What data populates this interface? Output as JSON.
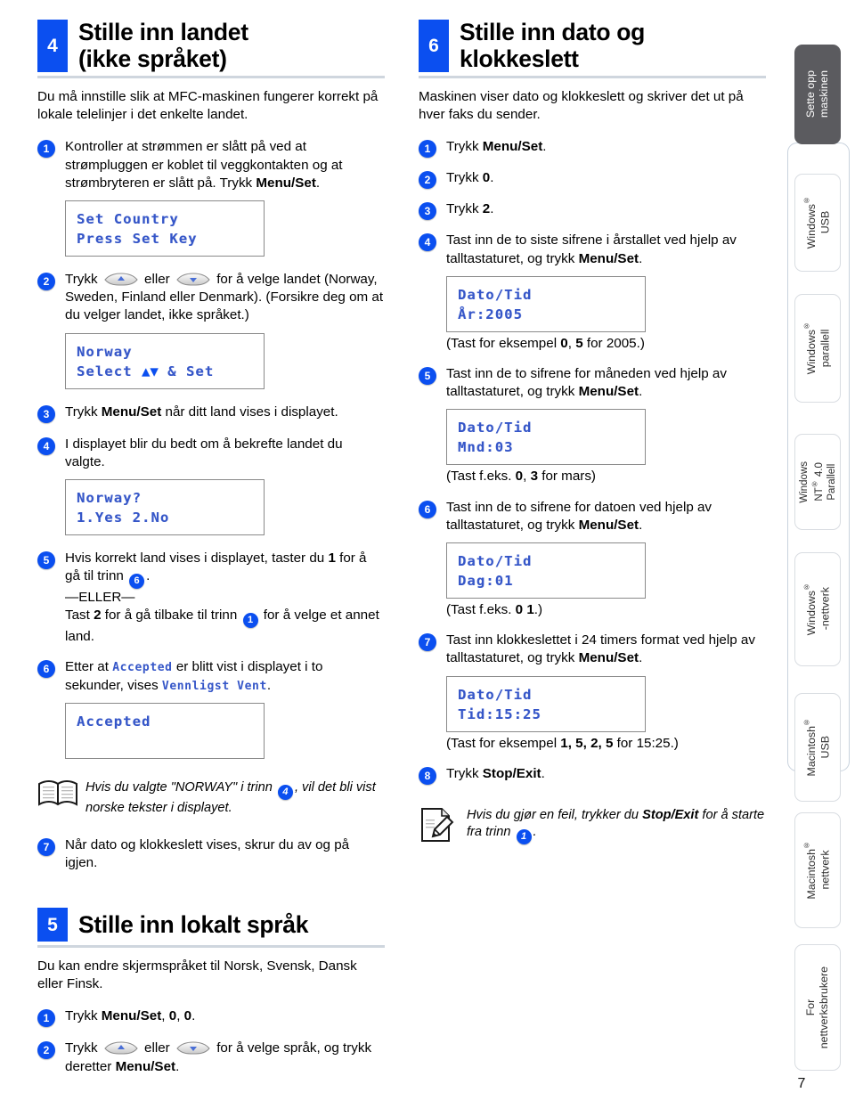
{
  "colors": {
    "accent_blue": "#0b4ff0",
    "lcd_text": "#3556c8",
    "rule_gray": "#cfd6de",
    "tab_active_bg": "#5b5b5f"
  },
  "page_number": "7",
  "left_column": {
    "section4": {
      "number": "4",
      "title_line1": "Stille inn landet",
      "title_line2": "(ikke språket)",
      "intro": "Du må innstille slik at MFC-maskinen fungerer korrekt på lokale telelinjer i det enkelte landet.",
      "steps": [
        {
          "num": "1",
          "text_before": "Kontroller at strømmen er slått på ved at strømpluggen er koblet til veggkontakten og at strømbryteren er slått på. Trykk ",
          "bold": "Menu/Set",
          "text_after": ".",
          "lcd": [
            "Set Country",
            "Press Set Key"
          ]
        },
        {
          "num": "2",
          "pre": "Trykk",
          "mid": "eller",
          "post": "for å velge landet (Norway, Sweden, Finland eller Denmark). (Forsikre deg om at du velger landet, ikke språket.)",
          "lcd_line1": "Norway",
          "lcd_line2_pre": "Select ",
          "lcd_line2_arrows": "▲▼",
          "lcd_line2_post": " & Set"
        },
        {
          "num": "3",
          "text_before": "Trykk ",
          "bold": "Menu/Set",
          "text_after": " når ditt land vises i displayet."
        },
        {
          "num": "4",
          "text": "I displayet blir du bedt om å bekrefte landet du valgte.",
          "lcd": [
            "Norway?",
            "1.Yes 2.No"
          ]
        },
        {
          "num": "5",
          "l1a": "Hvis korrekt land vises i displayet, taster du ",
          "l1b": "1",
          "l1c": " for å gå til trinn ",
          "l1ref": "6",
          "l1d": ".",
          "l2": "—ELLER—",
          "l3a": "Tast ",
          "l3b": "2",
          "l3c": " for å gå tilbake til trinn ",
          "l3ref": "1",
          "l3d": " for å velge et annet land."
        },
        {
          "num": "6",
          "a": "Etter at ",
          "lcd_a": "Accepted",
          "b": " er blitt vist i displayet i to sekunder, vises ",
          "lcd_b": "Vennligst Vent",
          "c": ".",
          "lcd": [
            "Accepted",
            ""
          ]
        }
      ],
      "tip": {
        "icon": "open-book-icon",
        "a": "Hvis du valgte \"NORWAY\" i trinn ",
        "ref": "4",
        "b": ", vil det bli vist norske tekster i displayet."
      },
      "step7": {
        "num": "7",
        "text": "Når dato og klokkeslett vises, skrur du av og på igjen."
      }
    },
    "section5": {
      "number": "5",
      "title": "Stille inn lokalt språk",
      "intro": "Du kan endre skjermspråket til Norsk, Svensk, Dansk eller Finsk.",
      "steps": [
        {
          "num": "1",
          "text_before": "Trykk ",
          "bold": "Menu/Set",
          "text_after": ", 0, 0.",
          "bold_0a": "0",
          "bold_0b": "0"
        },
        {
          "num": "2",
          "pre": "Trykk",
          "mid": "eller",
          "post": "for å velge språk, og trykk deretter ",
          "bold": "Menu/Set",
          "end": "."
        }
      ]
    }
  },
  "right_column": {
    "section6": {
      "number": "6",
      "title_line1": "Stille inn dato og",
      "title_line2": "klokkeslett",
      "intro": "Maskinen viser dato og klokkeslett og skriver det ut på hver faks du sender.",
      "steps": [
        {
          "num": "1",
          "text_before": "Trykk ",
          "bold": "Menu/Set",
          "text_after": "."
        },
        {
          "num": "2",
          "text_before": "Trykk ",
          "bold": "0",
          "text_after": "."
        },
        {
          "num": "3",
          "text_before": "Trykk ",
          "bold": "2",
          "text_after": "."
        },
        {
          "num": "4",
          "text_before": "Tast inn de to siste sifrene i årstallet ved hjelp av talltastaturet, og trykk ",
          "bold": "Menu/Set",
          "text_after": ".",
          "lcd": [
            "Dato/Tid",
            "År:2005"
          ],
          "note_a": "(Tast for eksempel ",
          "note_b1": "0",
          "note_mid": ", ",
          "note_b2": "5",
          "note_c": " for 2005.)"
        },
        {
          "num": "5",
          "text_before": "Tast inn de to sifrene for måneden ved hjelp av talltastaturet, og trykk ",
          "bold": "Menu/Set",
          "text_after": ".",
          "lcd": [
            "Dato/Tid",
            "Mnd:03"
          ],
          "note_a": "(Tast f.eks. ",
          "note_b1": "0",
          "note_mid": ", ",
          "note_b2": "3",
          "note_c": " for mars)"
        },
        {
          "num": "6",
          "text_before": "Tast inn de to sifrene for datoen ved hjelp av talltastaturet, og trykk ",
          "bold": "Menu/Set",
          "text_after": ".",
          "lcd": [
            "Dato/Tid",
            "Dag:01"
          ],
          "note_a": "(Tast f.eks. ",
          "note_b1": "0 1",
          "note_c": ".)"
        },
        {
          "num": "7",
          "text_before": "Tast inn klokkeslettet i 24 timers format ved hjelp av talltastaturet, og trykk ",
          "bold": "Menu/Set",
          "text_after": ".",
          "lcd": [
            "Dato/Tid",
            "Tid:15:25"
          ],
          "note_a": "(Tast for eksempel ",
          "note_b": "1, 5, 2, 5",
          "note_c": " for 15:25.)"
        },
        {
          "num": "8",
          "text_before": "Trykk ",
          "bold": "Stop/Exit",
          "text_after": "."
        }
      ],
      "tip": {
        "icon": "note-pencil-icon",
        "a": "Hvis du gjør en feil, trykker du ",
        "bold": "Stop/Exit",
        "b": " for å starte fra trinn ",
        "ref": "1",
        "c": "."
      }
    }
  },
  "sidebar": {
    "tabs": [
      {
        "id": "sette-opp-maskinen",
        "line1": "Sette opp",
        "line2": "maskinen",
        "active": true,
        "reg": false
      },
      {
        "id": "windows-usb",
        "line1": "Windows",
        "line2": "USB",
        "active": false,
        "reg": true
      },
      {
        "id": "windows-parallell",
        "line1": "Windows",
        "line2": "parallell",
        "active": false,
        "reg": true
      },
      {
        "id": "windows-nt-40-parallell",
        "line1": "Windows",
        "line2": "NT",
        "line3": "4.0",
        "line4": "Parallell",
        "active": false,
        "reg": true
      },
      {
        "id": "windows-nettverk",
        "line1": "Windows",
        "line2": "-nettverk",
        "active": false,
        "reg": true
      },
      {
        "id": "macintosh-usb",
        "line1": "Macintosh",
        "line2": "USB",
        "active": false,
        "reg": true
      },
      {
        "id": "macintosh-nettverk",
        "line1": "Macintosh",
        "line2": "nettverk",
        "active": false,
        "reg": true
      },
      {
        "id": "for-nettverksbrukere",
        "line1": "For",
        "line2": "nettverksbrukere",
        "active": false,
        "reg": false
      }
    ]
  }
}
